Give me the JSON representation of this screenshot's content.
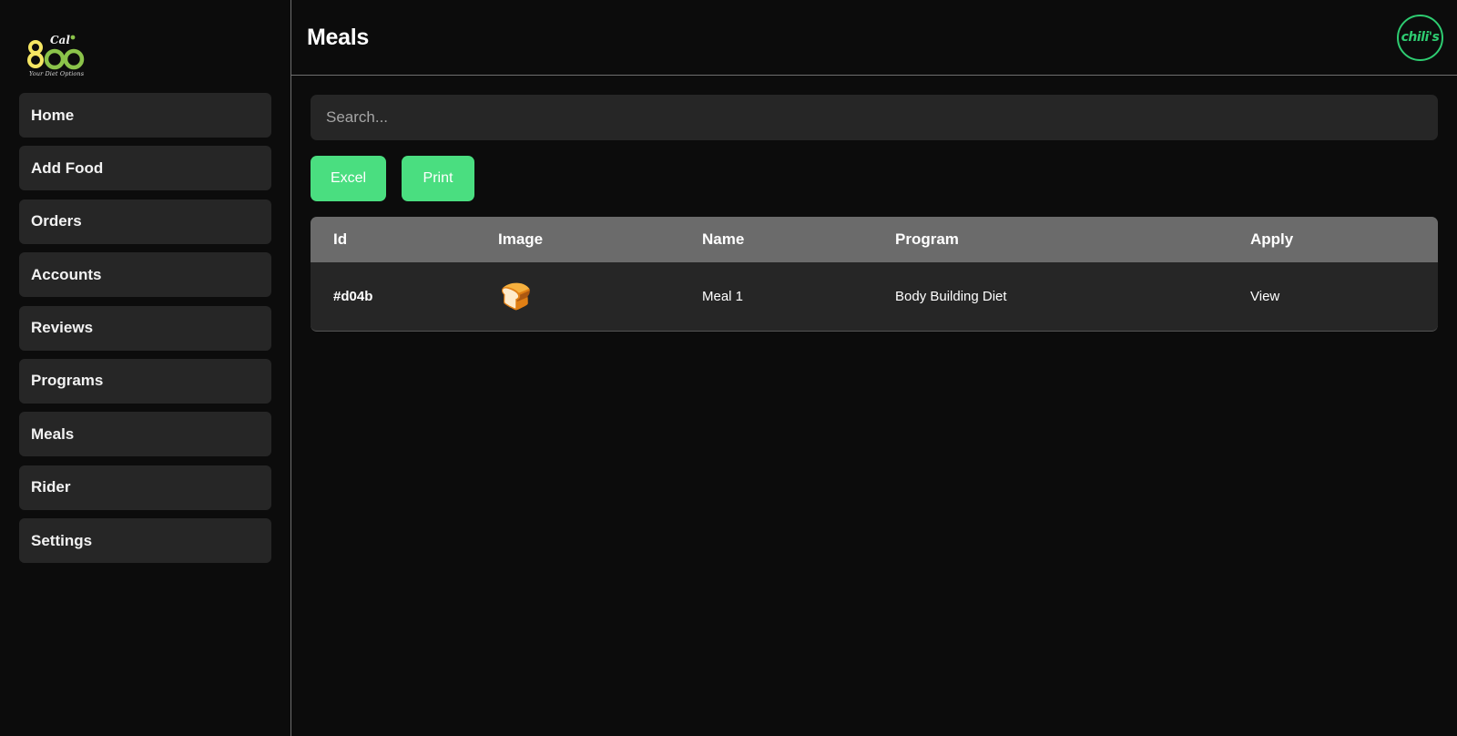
{
  "logo": {
    "top_text": "Cal",
    "number": "800",
    "tagline": "Your Diet Options",
    "colors": {
      "green": "#8bc34a",
      "yellow": "#f5e663"
    }
  },
  "sidebar": {
    "items": [
      {
        "label": "Home"
      },
      {
        "label": "Add Food"
      },
      {
        "label": "Orders"
      },
      {
        "label": "Accounts"
      },
      {
        "label": "Reviews"
      },
      {
        "label": "Programs"
      },
      {
        "label": "Meals"
      },
      {
        "label": "Rider"
      },
      {
        "label": "Settings"
      }
    ]
  },
  "header": {
    "title": "Meals",
    "brand_avatar": "chili's"
  },
  "search": {
    "placeholder": "Search...",
    "value": ""
  },
  "actions": {
    "excel_label": "Excel",
    "print_label": "Print"
  },
  "table": {
    "columns": [
      "Id",
      "Image",
      "Name",
      "Program",
      "Apply"
    ],
    "rows": [
      {
        "id": "#d04b",
        "image_icon": "bread-icon",
        "image_glyph": "🍞",
        "name": "Meal 1",
        "program": "Body Building Diet",
        "apply": "View"
      }
    ]
  },
  "colors": {
    "background": "#0c0c0c",
    "panel": "#262626",
    "accent": "#4ade80",
    "brand": "#2ecc71"
  }
}
